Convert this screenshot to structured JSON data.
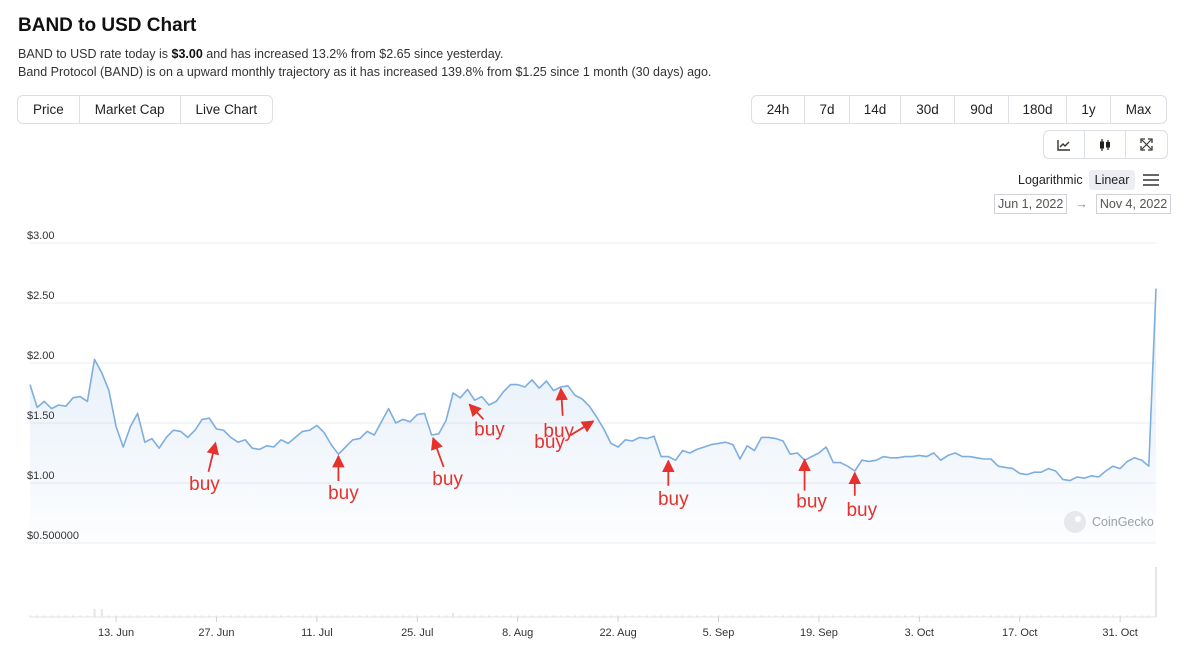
{
  "header": {
    "title": "BAND to USD Chart",
    "desc1_a": "BAND to USD rate today is ",
    "desc1_price": "$3.00",
    "desc1_b": " and has increased 13.2% from $2.65 since yesterday.",
    "desc2": "Band Protocol (BAND) is on a upward monthly trajectory as it has increased 139.8% from $1.25 since 1 month (30 days) ago."
  },
  "tabs": [
    {
      "label": "Price",
      "active": true
    },
    {
      "label": "Market Cap",
      "active": false
    },
    {
      "label": "Live Chart",
      "active": false
    }
  ],
  "ranges": [
    {
      "label": "24h",
      "active": true
    },
    {
      "label": "7d",
      "active": false
    },
    {
      "label": "14d",
      "active": false
    },
    {
      "label": "30d",
      "active": false
    },
    {
      "label": "90d",
      "active": false
    },
    {
      "label": "180d",
      "active": false
    },
    {
      "label": "1y",
      "active": false
    },
    {
      "label": "Max",
      "active": false
    }
  ],
  "chart_types": [
    {
      "icon": "line-chart-icon",
      "active": true
    },
    {
      "icon": "candlestick-icon",
      "active": false
    },
    {
      "icon": "expand-icon",
      "active": false
    }
  ],
  "scale": {
    "log_label": "Logarithmic",
    "linear_label": "Linear",
    "active": "Linear"
  },
  "date_range": {
    "from": "Jun 1, 2022",
    "arrow": "→",
    "to": "Nov 4, 2022"
  },
  "watermark": "CoinGecko",
  "colors": {
    "line": "#7eaee0",
    "annotation": "#e6322c"
  },
  "chart_data": {
    "type": "area",
    "x_start": "2022-06-01",
    "x_end": "2022-11-04",
    "ylim": [
      0.5,
      3.0
    ],
    "y_ticks": [
      {
        "value": 3.0,
        "label": "$3.00"
      },
      {
        "value": 2.5,
        "label": "$2.50"
      },
      {
        "value": 2.0,
        "label": "$2.00"
      },
      {
        "value": 1.5,
        "label": "$1.50"
      },
      {
        "value": 1.0,
        "label": "$1.00"
      },
      {
        "value": 0.5,
        "label": "$0.500000"
      }
    ],
    "x_ticks": [
      {
        "date": "2022-06-13",
        "label": "13. Jun"
      },
      {
        "date": "2022-06-27",
        "label": "27. Jun"
      },
      {
        "date": "2022-07-11",
        "label": "11. Jul"
      },
      {
        "date": "2022-07-25",
        "label": "25. Jul"
      },
      {
        "date": "2022-08-08",
        "label": "8. Aug"
      },
      {
        "date": "2022-08-22",
        "label": "22. Aug"
      },
      {
        "date": "2022-09-05",
        "label": "5. Sep"
      },
      {
        "date": "2022-09-19",
        "label": "19. Sep"
      },
      {
        "date": "2022-10-03",
        "label": "3. Oct"
      },
      {
        "date": "2022-10-17",
        "label": "17. Oct"
      },
      {
        "date": "2022-10-31",
        "label": "31. Oct"
      }
    ],
    "series": [
      {
        "values": [
          [
            "2022-06-01",
            1.82
          ],
          [
            "2022-06-02",
            1.63
          ],
          [
            "2022-06-03",
            1.68
          ],
          [
            "2022-06-04",
            1.62
          ],
          [
            "2022-06-05",
            1.65
          ],
          [
            "2022-06-06",
            1.64
          ],
          [
            "2022-06-07",
            1.71
          ],
          [
            "2022-06-08",
            1.72
          ],
          [
            "2022-06-09",
            1.68
          ],
          [
            "2022-06-10",
            2.03
          ],
          [
            "2022-06-11",
            1.92
          ],
          [
            "2022-06-12",
            1.77
          ],
          [
            "2022-06-13",
            1.47
          ],
          [
            "2022-06-14",
            1.3
          ],
          [
            "2022-06-15",
            1.47
          ],
          [
            "2022-06-16",
            1.58
          ],
          [
            "2022-06-17",
            1.34
          ],
          [
            "2022-06-18",
            1.37
          ],
          [
            "2022-06-19",
            1.29
          ],
          [
            "2022-06-20",
            1.38
          ],
          [
            "2022-06-21",
            1.44
          ],
          [
            "2022-06-22",
            1.43
          ],
          [
            "2022-06-23",
            1.38
          ],
          [
            "2022-06-24",
            1.44
          ],
          [
            "2022-06-25",
            1.53
          ],
          [
            "2022-06-26",
            1.54
          ],
          [
            "2022-06-27",
            1.45
          ],
          [
            "2022-06-28",
            1.44
          ],
          [
            "2022-06-29",
            1.38
          ],
          [
            "2022-06-30",
            1.34
          ],
          [
            "2022-07-01",
            1.36
          ],
          [
            "2022-07-02",
            1.29
          ],
          [
            "2022-07-03",
            1.28
          ],
          [
            "2022-07-04",
            1.31
          ],
          [
            "2022-07-05",
            1.3
          ],
          [
            "2022-07-06",
            1.36
          ],
          [
            "2022-07-07",
            1.33
          ],
          [
            "2022-07-08",
            1.38
          ],
          [
            "2022-07-09",
            1.43
          ],
          [
            "2022-07-10",
            1.44
          ],
          [
            "2022-07-11",
            1.48
          ],
          [
            "2022-07-12",
            1.42
          ],
          [
            "2022-07-13",
            1.32
          ],
          [
            "2022-07-14",
            1.24
          ],
          [
            "2022-07-15",
            1.3
          ],
          [
            "2022-07-16",
            1.36
          ],
          [
            "2022-07-17",
            1.37
          ],
          [
            "2022-07-18",
            1.43
          ],
          [
            "2022-07-19",
            1.4
          ],
          [
            "2022-07-20",
            1.51
          ],
          [
            "2022-07-21",
            1.62
          ],
          [
            "2022-07-22",
            1.5
          ],
          [
            "2022-07-23",
            1.53
          ],
          [
            "2022-07-24",
            1.51
          ],
          [
            "2022-07-25",
            1.57
          ],
          [
            "2022-07-26",
            1.58
          ],
          [
            "2022-07-27",
            1.4
          ],
          [
            "2022-07-28",
            1.41
          ],
          [
            "2022-07-29",
            1.52
          ],
          [
            "2022-07-30",
            1.75
          ],
          [
            "2022-07-31",
            1.71
          ],
          [
            "2022-08-01",
            1.78
          ],
          [
            "2022-08-02",
            1.69
          ],
          [
            "2022-08-03",
            1.72
          ],
          [
            "2022-08-04",
            1.65
          ],
          [
            "2022-08-05",
            1.68
          ],
          [
            "2022-08-06",
            1.76
          ],
          [
            "2022-08-07",
            1.82
          ],
          [
            "2022-08-08",
            1.82
          ],
          [
            "2022-08-09",
            1.8
          ],
          [
            "2022-08-10",
            1.86
          ],
          [
            "2022-08-11",
            1.79
          ],
          [
            "2022-08-12",
            1.85
          ],
          [
            "2022-08-13",
            1.77
          ],
          [
            "2022-08-14",
            1.8
          ],
          [
            "2022-08-15",
            1.81
          ],
          [
            "2022-08-16",
            1.73
          ],
          [
            "2022-08-17",
            1.7
          ],
          [
            "2022-08-18",
            1.64
          ],
          [
            "2022-08-19",
            1.55
          ],
          [
            "2022-08-20",
            1.45
          ],
          [
            "2022-08-21",
            1.33
          ],
          [
            "2022-08-22",
            1.3
          ],
          [
            "2022-08-23",
            1.36
          ],
          [
            "2022-08-24",
            1.35
          ],
          [
            "2022-08-25",
            1.38
          ],
          [
            "2022-08-26",
            1.37
          ],
          [
            "2022-08-27",
            1.39
          ],
          [
            "2022-08-28",
            1.22
          ],
          [
            "2022-08-29",
            1.22
          ],
          [
            "2022-08-30",
            1.19
          ],
          [
            "2022-08-31",
            1.27
          ],
          [
            "2022-09-01",
            1.25
          ],
          [
            "2022-09-02",
            1.28
          ],
          [
            "2022-09-03",
            1.3
          ],
          [
            "2022-09-04",
            1.32
          ],
          [
            "2022-09-05",
            1.33
          ],
          [
            "2022-09-06",
            1.34
          ],
          [
            "2022-09-07",
            1.32
          ],
          [
            "2022-09-08",
            1.2
          ],
          [
            "2022-09-09",
            1.31
          ],
          [
            "2022-09-10",
            1.27
          ],
          [
            "2022-09-11",
            1.38
          ],
          [
            "2022-09-12",
            1.38
          ],
          [
            "2022-09-13",
            1.37
          ],
          [
            "2022-09-14",
            1.35
          ],
          [
            "2022-09-15",
            1.24
          ],
          [
            "2022-09-16",
            1.25
          ],
          [
            "2022-09-17",
            1.19
          ],
          [
            "2022-09-18",
            1.22
          ],
          [
            "2022-09-19",
            1.25
          ],
          [
            "2022-09-20",
            1.3
          ],
          [
            "2022-09-21",
            1.17
          ],
          [
            "2022-09-22",
            1.17
          ],
          [
            "2022-09-23",
            1.14
          ],
          [
            "2022-09-24",
            1.1
          ],
          [
            "2022-09-25",
            1.19
          ],
          [
            "2022-09-26",
            1.18
          ],
          [
            "2022-09-27",
            1.19
          ],
          [
            "2022-09-28",
            1.22
          ],
          [
            "2022-09-29",
            1.21
          ],
          [
            "2022-09-30",
            1.21
          ],
          [
            "2022-10-01",
            1.22
          ],
          [
            "2022-10-02",
            1.22
          ],
          [
            "2022-10-03",
            1.23
          ],
          [
            "2022-10-04",
            1.22
          ],
          [
            "2022-10-05",
            1.25
          ],
          [
            "2022-10-06",
            1.19
          ],
          [
            "2022-10-07",
            1.23
          ],
          [
            "2022-10-08",
            1.25
          ],
          [
            "2022-10-09",
            1.22
          ],
          [
            "2022-10-10",
            1.22
          ],
          [
            "2022-10-11",
            1.21
          ],
          [
            "2022-10-12",
            1.2
          ],
          [
            "2022-10-13",
            1.2
          ],
          [
            "2022-10-14",
            1.14
          ],
          [
            "2022-10-15",
            1.13
          ],
          [
            "2022-10-16",
            1.12
          ],
          [
            "2022-10-17",
            1.08
          ],
          [
            "2022-10-18",
            1.07
          ],
          [
            "2022-10-19",
            1.09
          ],
          [
            "2022-10-20",
            1.09
          ],
          [
            "2022-10-21",
            1.12
          ],
          [
            "2022-10-22",
            1.1
          ],
          [
            "2022-10-23",
            1.03
          ],
          [
            "2022-10-24",
            1.02
          ],
          [
            "2022-10-25",
            1.05
          ],
          [
            "2022-10-26",
            1.04
          ],
          [
            "2022-10-27",
            1.06
          ],
          [
            "2022-10-28",
            1.05
          ],
          [
            "2022-10-29",
            1.1
          ],
          [
            "2022-10-30",
            1.14
          ],
          [
            "2022-10-31",
            1.12
          ],
          [
            "2022-11-01",
            1.18
          ],
          [
            "2022-11-02",
            1.21
          ],
          [
            "2022-11-03",
            1.19
          ],
          [
            "2022-11-04",
            1.14
          ],
          [
            "2022-11-05",
            2.62
          ]
        ]
      }
    ],
    "annotations": [
      {
        "text": "buy",
        "date": "2022-06-27",
        "value": 1.36
      },
      {
        "text": "buy",
        "date": "2022-07-14",
        "value": 1.25
      },
      {
        "text": "buy",
        "date": "2022-07-27",
        "value": 1.4
      },
      {
        "text": "buy",
        "date": "2022-08-01",
        "value": 1.68
      },
      {
        "text": "buy",
        "date": "2022-08-14",
        "value": 1.81
      },
      {
        "text": "buy",
        "date": "2022-08-19",
        "value": 1.54
      },
      {
        "text": "buy",
        "date": "2022-08-29",
        "value": 1.21
      },
      {
        "text": "buy",
        "date": "2022-09-17",
        "value": 1.22
      },
      {
        "text": "buy",
        "date": "2022-09-24",
        "value": 1.11
      }
    ],
    "grid": true
  }
}
